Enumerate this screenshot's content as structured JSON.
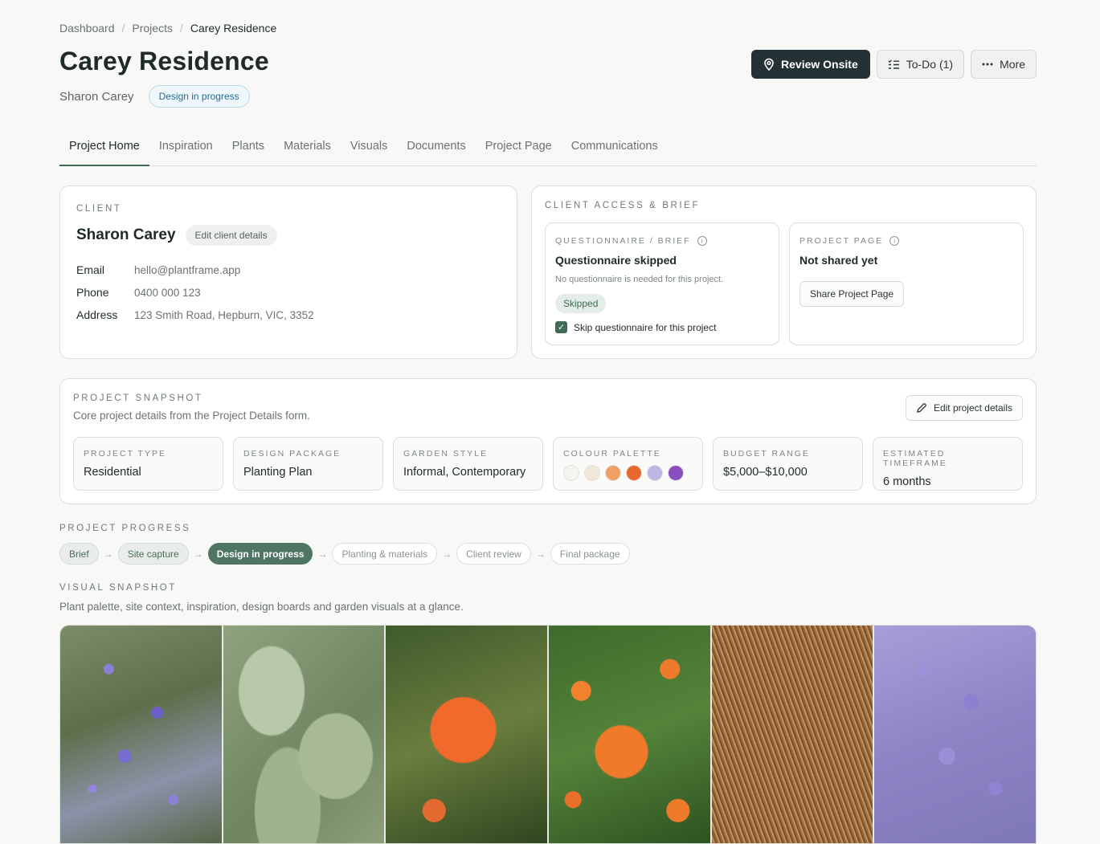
{
  "breadcrumb": {
    "items": [
      "Dashboard",
      "Projects"
    ],
    "current": "Carey Residence",
    "separator": "/"
  },
  "header": {
    "title": "Carey Residence",
    "client": "Sharon Carey",
    "status": "Design in progress",
    "actions": {
      "review": "Review Onsite",
      "todo": "To-Do (1)",
      "more": "More"
    }
  },
  "tabs": [
    "Project Home",
    "Inspiration",
    "Plants",
    "Materials",
    "Visuals",
    "Documents",
    "Project Page",
    "Communications"
  ],
  "client_card": {
    "eyebrow": "CLIENT",
    "name": "Sharon Carey",
    "edit_label": "Edit client details",
    "email_label": "Email",
    "email": "hello@plantframe.app",
    "phone_label": "Phone",
    "phone": "0400 000 123",
    "address_label": "Address",
    "address": "123 Smith Road, Hepburn, VIC, 3352"
  },
  "access_card": {
    "eyebrow": "CLIENT ACCESS & BRIEF",
    "questionnaire": {
      "eyebrow": "QUESTIONNAIRE / BRIEF",
      "title": "Questionnaire skipped",
      "note": "No questionnaire is needed for this project.",
      "pill": "Skipped",
      "checkbox_label": "Skip questionnaire for this project"
    },
    "project_page": {
      "eyebrow": "PROJECT PAGE",
      "title": "Not shared yet",
      "share_label": "Share Project Page"
    }
  },
  "snapshot": {
    "eyebrow": "PROJECT SNAPSHOT",
    "desc": "Core project details from the Project Details form.",
    "edit_label": "Edit project details",
    "type_label": "PROJECT TYPE",
    "type": "Residential",
    "package_label": "DESIGN PACKAGE",
    "package": "Planting Plan",
    "style_label": "GARDEN STYLE",
    "style": "Informal, Contemporary",
    "palette_label": "COLOUR PALETTE",
    "palette": [
      "#f4f4f1",
      "#f1e7d8",
      "#f0a065",
      "#e8682d",
      "#c1b5e3",
      "#8a4fbf"
    ],
    "budget_label": "BUDGET RANGE",
    "budget": "$5,000–$10,000",
    "timeframe_label": "ESTIMATED TIMEFRAME",
    "timeframe": "6 months"
  },
  "progress": {
    "eyebrow": "PROJECT PROGRESS",
    "steps": [
      "Brief",
      "Site capture",
      "Design in progress",
      "Planting & materials",
      "Client review",
      "Final package"
    ]
  },
  "visual": {
    "eyebrow": "VISUAL SNAPSHOT",
    "desc": "Plant palette, site context, inspiration, design boards and garden visuals at a glance."
  },
  "colors": {
    "accent": "#3d6b57",
    "dark_button": "#233135",
    "status_blue": "#2a6a8e"
  }
}
